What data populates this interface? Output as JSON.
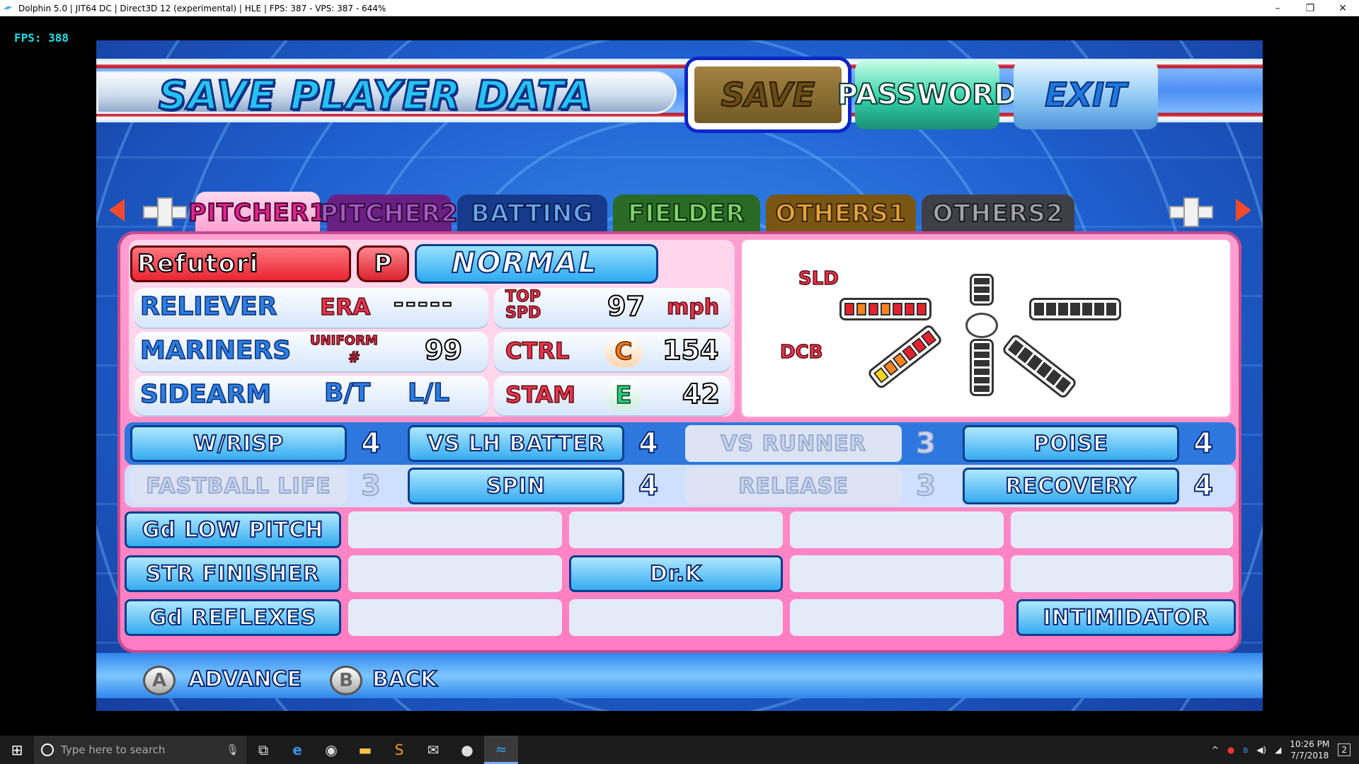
{
  "window": {
    "title": "Dolphin 5.0 | JIT64 DC | Direct3D 12 (experimental) | HLE | FPS: 387 - VPS: 387 - 644%",
    "minimize": "–",
    "restore": "❐",
    "close": "✕"
  },
  "overlay": {
    "fps": "FPS: 388"
  },
  "header": {
    "title": "SAVE PLAYER DATA",
    "buttons": {
      "save": "SAVE",
      "password": "PASSWORD",
      "exit": "EXIT"
    }
  },
  "tabs": [
    "PITCHER1",
    "PITCHER2",
    "BATTING",
    "FIELDER",
    "OTHERS1",
    "OTHERS2"
  ],
  "player": {
    "name": "Refutori",
    "position": "P",
    "condition": "NORMAL",
    "role": "RELIEVER",
    "era_label": "ERA",
    "era_value": "-----",
    "top_spd_label_1": "TOP",
    "top_spd_label_2": "SPD",
    "top_spd_value": "97",
    "top_spd_unit": "mph",
    "team": "MARINERS",
    "uniform_label_1": "UNIFORM",
    "uniform_label_2": "#",
    "uniform_value": "99",
    "ctrl_label": "CTRL",
    "ctrl_grade": "C",
    "ctrl_value": "154",
    "arm_style": "SIDEARM",
    "bt_label": "B/T",
    "bt_value": "L/L",
    "stam_label": "STAM",
    "stam_grade": "E",
    "stam_value": "42"
  },
  "pitch_chart": {
    "labels": {
      "slider": "SLD",
      "dcb": "DCB"
    },
    "colors": {
      "red": "#e8202e",
      "orange": "#f7831e",
      "yellow": "#f5d21a",
      "empty": "#ffffff",
      "dark": "#333333"
    }
  },
  "abilities": {
    "rated": [
      {
        "name": "W/RISP",
        "level": "4",
        "active": true
      },
      {
        "name": "VS LH BATTER",
        "level": "4",
        "active": true
      },
      {
        "name": "VS RUNNER",
        "level": "3",
        "active": false
      },
      {
        "name": "POISE",
        "level": "4",
        "active": true
      },
      {
        "name": "FASTBALL LIFE",
        "level": "3",
        "active": false
      },
      {
        "name": "SPIN",
        "level": "4",
        "active": true
      },
      {
        "name": "RELEASE",
        "level": "3",
        "active": false
      },
      {
        "name": "RECOVERY",
        "level": "4",
        "active": true
      }
    ],
    "special_rows": [
      {
        "label": "Gd LOW PITCH",
        "cells": [
          "",
          "",
          "",
          ""
        ]
      },
      {
        "label": "STR FINISHER",
        "cells": [
          "",
          "Dr.K",
          "",
          ""
        ]
      },
      {
        "label": "Gd REFLEXES",
        "cells": [
          "",
          "",
          "",
          "INTIMIDATOR"
        ]
      }
    ]
  },
  "prompts": {
    "a_button": "A",
    "a_action": "ADVANCE",
    "b_button": "B",
    "b_action": "BACK"
  },
  "taskbar": {
    "search_placeholder": "Type here to search",
    "time": "10:26 PM",
    "date": "7/7/2018",
    "notifications": "2"
  }
}
